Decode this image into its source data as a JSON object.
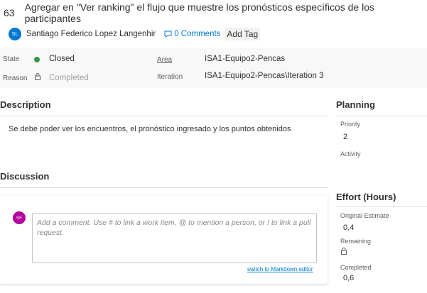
{
  "work_item": {
    "id": "63",
    "title": "Agregar en \"Ver ranking\" el flujo que muestre los pronósticos específicos de los participantes"
  },
  "assignee": {
    "initials": "SL",
    "name": "Santiago Federico Lopez Langenhir"
  },
  "comments_link": "0 Comments",
  "add_tag": "Add Tag",
  "fields": {
    "state_label": "State",
    "state_value": "Closed",
    "reason_label": "Reason",
    "reason_value": "Completed",
    "area_label": "Area",
    "area_value": "ISA1-Equipo2-Pencas",
    "iteration_label": "Iteration",
    "iteration_value": "ISA1-Equipo2-Pencas\\Iteration 3"
  },
  "description": {
    "heading": "Description",
    "text": "Se debe poder ver los encuentros, el pronóstico ingresado y los puntos obtenidos"
  },
  "discussion": {
    "heading": "Discussion",
    "avatar_initials": "SF",
    "placeholder": "Add a comment. Use # to link a work item, @ to mention a person, or ! to link a pull request.",
    "markdown_link": "switch to Markdown editor"
  },
  "planning": {
    "heading": "Planning",
    "priority_label": "Priority",
    "priority_value": "2",
    "activity_label": "Activity"
  },
  "effort": {
    "heading": "Effort (Hours)",
    "original_label": "Original Estimate",
    "original_value": "0,4",
    "remaining_label": "Remaining",
    "completed_label": "Completed",
    "completed_value": "0,6"
  },
  "colors": {
    "accent": "#0078d4",
    "closed_state": "#339947",
    "sf_avatar": "#b4009e"
  }
}
